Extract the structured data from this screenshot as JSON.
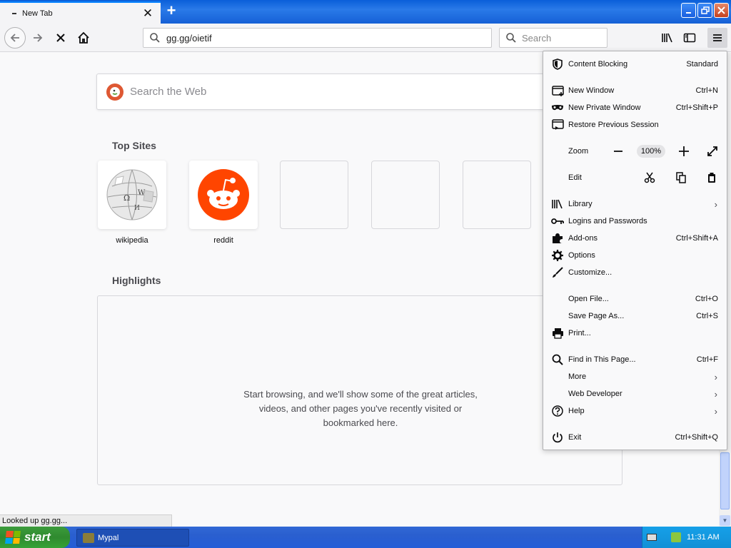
{
  "window": {
    "tab_title": "New Tab",
    "new_tab_symbol": "+",
    "min_symbol": "_",
    "max_symbol": "❐",
    "close_symbol": "✕"
  },
  "navbar": {
    "url": "gg.gg/oietif",
    "search_placeholder": "Search"
  },
  "newtab": {
    "search_placeholder": "Search the Web",
    "top_sites_title": "Top Sites",
    "top_sites": [
      {
        "label": "wikipedia"
      },
      {
        "label": "reddit"
      },
      {
        "label": ""
      },
      {
        "label": ""
      },
      {
        "label": ""
      }
    ],
    "highlights_title": "Highlights",
    "highlights_message": "Start browsing, and we'll show some of the great articles,\nvideos, and other pages you've recently visited or\nbookmarked here."
  },
  "status": "Looked up gg.gg...",
  "menu": {
    "content_blocking": {
      "label": "Content Blocking",
      "value": "Standard"
    },
    "new_window": {
      "label": "New Window",
      "shortcut": "Ctrl+N"
    },
    "new_private_window": {
      "label": "New Private Window",
      "shortcut": "Ctrl+Shift+P"
    },
    "restore_session": {
      "label": "Restore Previous Session"
    },
    "zoom": {
      "label": "Zoom",
      "value": "100%"
    },
    "edit": {
      "label": "Edit"
    },
    "library": {
      "label": "Library"
    },
    "logins": {
      "label": "Logins and Passwords"
    },
    "addons": {
      "label": "Add-ons",
      "shortcut": "Ctrl+Shift+A"
    },
    "options": {
      "label": "Options"
    },
    "customize": {
      "label": "Customize..."
    },
    "open_file": {
      "label": "Open File...",
      "shortcut": "Ctrl+O"
    },
    "save_page": {
      "label": "Save Page As...",
      "shortcut": "Ctrl+S"
    },
    "print": {
      "label": "Print..."
    },
    "find": {
      "label": "Find in This Page...",
      "shortcut": "Ctrl+F"
    },
    "more": {
      "label": "More"
    },
    "web_developer": {
      "label": "Web Developer"
    },
    "help": {
      "label": "Help"
    },
    "exit": {
      "label": "Exit",
      "shortcut": "Ctrl+Shift+Q"
    }
  },
  "taskbar": {
    "start_label": "start",
    "task_label": "Mypal",
    "clock": "11:31 AM"
  },
  "colors": {
    "reddit": "#ff4500",
    "duckduckgo": "#de5833",
    "xp_blue": "#245dd7",
    "xp_green": "#36a336"
  }
}
